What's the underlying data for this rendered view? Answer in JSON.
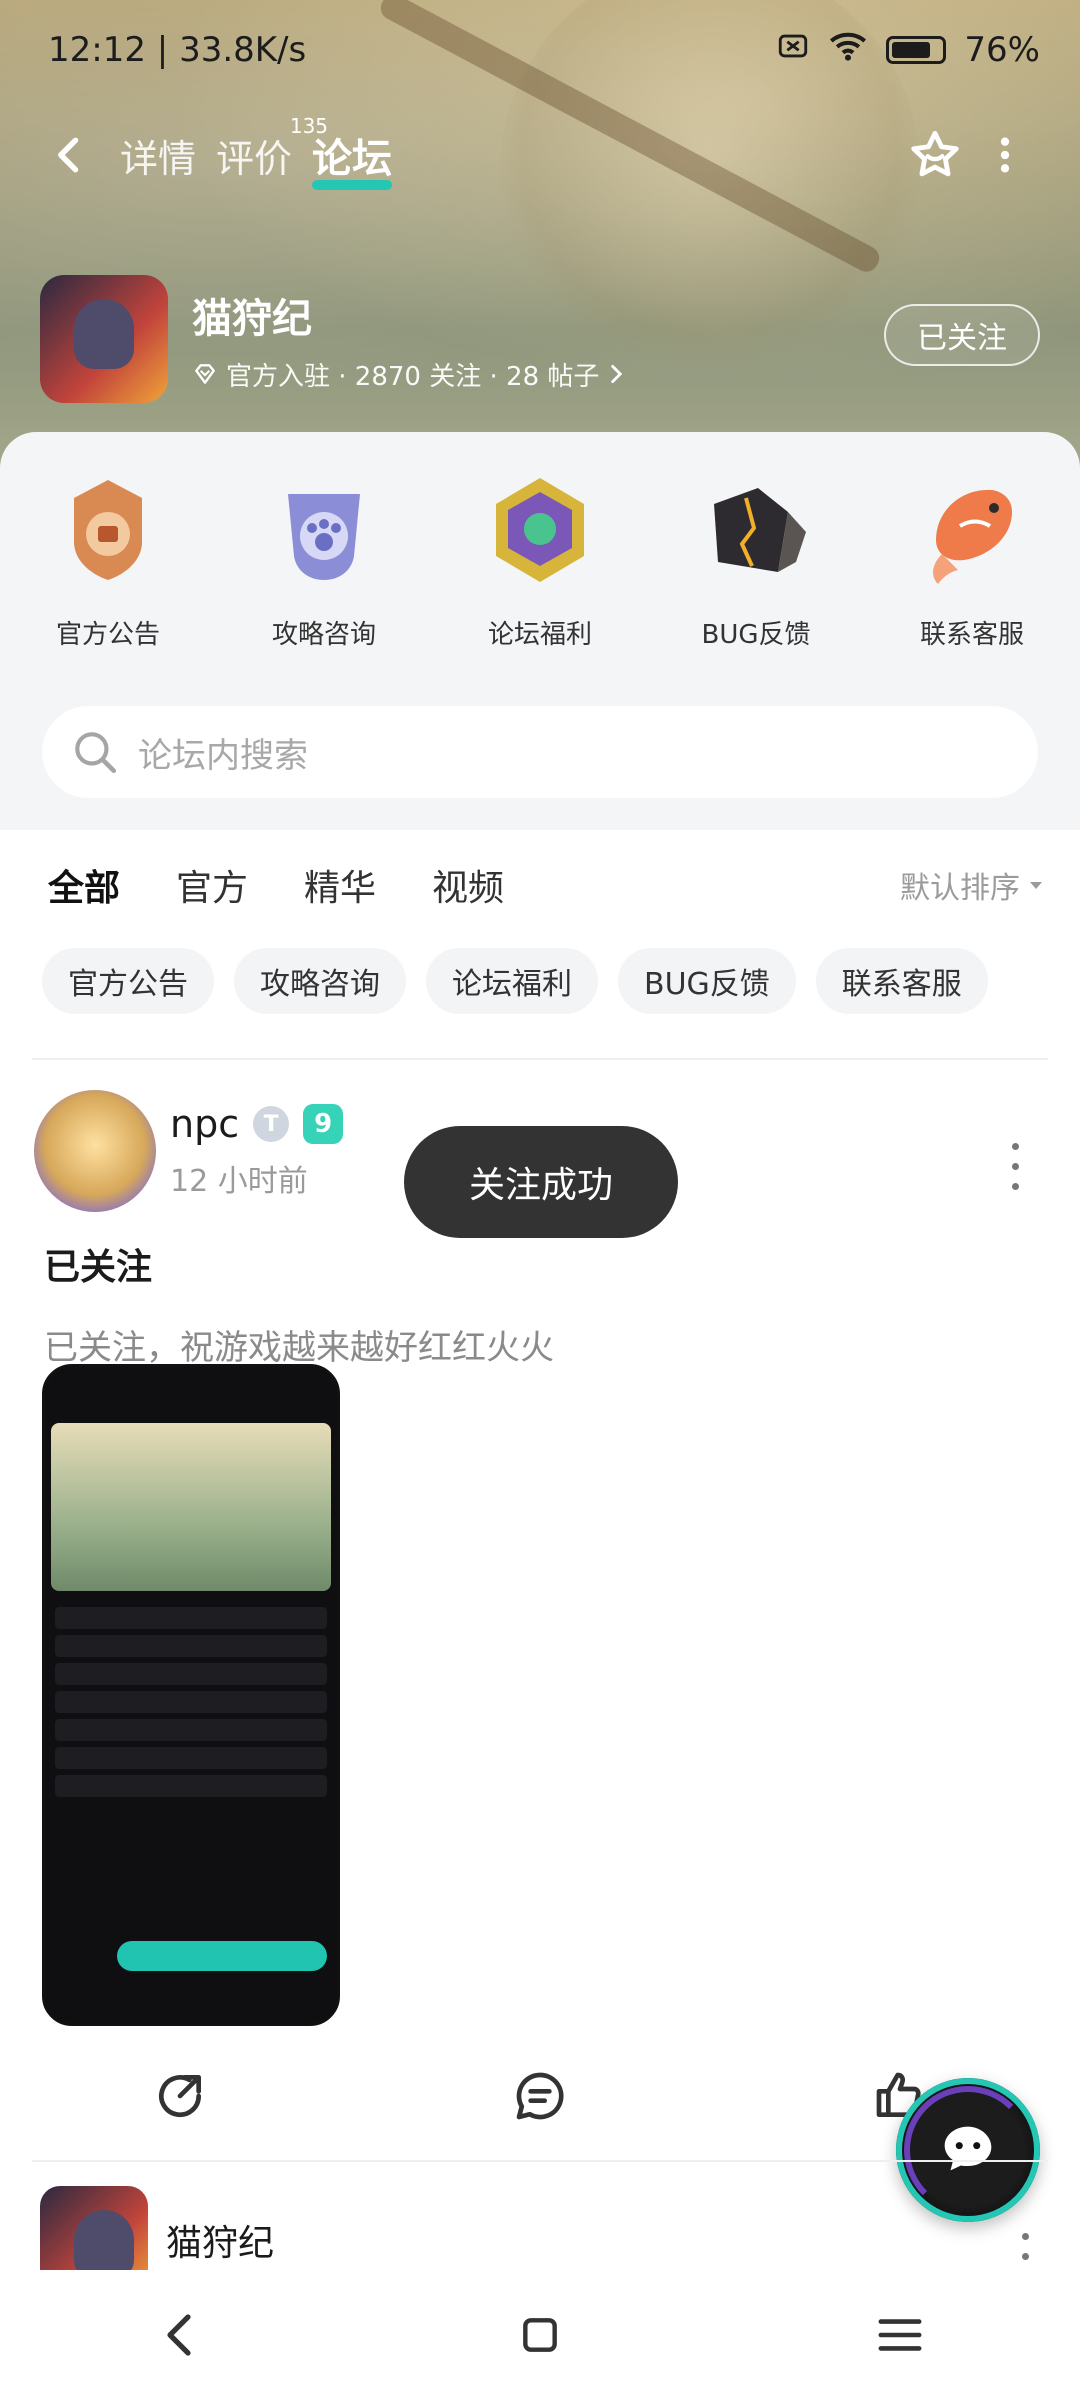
{
  "status_bar": {
    "time": "12:12",
    "speed": "33.8K/s",
    "battery": "76%"
  },
  "header": {
    "tabs": [
      {
        "label": "详情"
      },
      {
        "label": "评价",
        "count": "135"
      },
      {
        "label": "论坛"
      }
    ],
    "app": {
      "name": "猫狩纪",
      "meta": "官方入驻 · 2870 关注 · 28 帖子"
    },
    "follow_label": "已关注"
  },
  "quick_links": [
    {
      "label": "官方公告"
    },
    {
      "label": "攻略咨询"
    },
    {
      "label": "论坛福利"
    },
    {
      "label": "BUG反馈"
    },
    {
      "label": "联系客服"
    }
  ],
  "search": {
    "placeholder": "论坛内搜索"
  },
  "filters": {
    "tabs": [
      {
        "label": "全部"
      },
      {
        "label": "官方"
      },
      {
        "label": "精华"
      },
      {
        "label": "视频"
      }
    ],
    "sort": "默认排序"
  },
  "chips": [
    {
      "label": "官方公告"
    },
    {
      "label": "攻略咨询"
    },
    {
      "label": "论坛福利"
    },
    {
      "label": "BUG反馈"
    },
    {
      "label": "联系客服"
    }
  ],
  "post": {
    "user": "npc",
    "level_badge": "T",
    "level_num": "9",
    "time": "12 小时前",
    "title": "已关注",
    "body": "已关注，祝游戏越来越好红红火火"
  },
  "toast": "关注成功",
  "post2": {
    "name": "猫狩纪"
  },
  "colors": {
    "accent": "#24c6b4",
    "toast_bg": "#333333"
  }
}
